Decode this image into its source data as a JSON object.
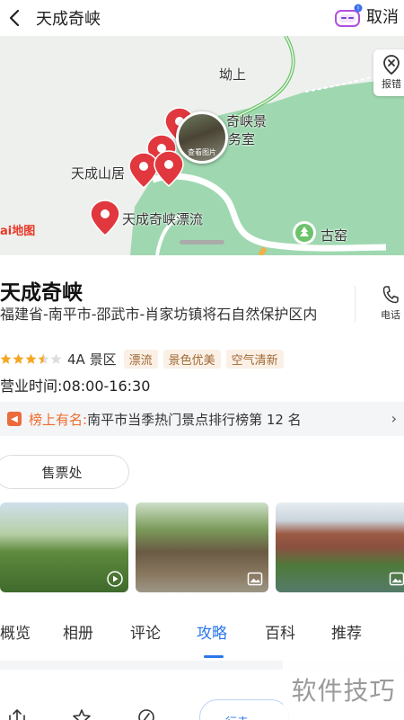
{
  "header": {
    "title": "天成奇峡",
    "cancel_label": "取消"
  },
  "map": {
    "labels": {
      "youshang": "坳上",
      "scenic_office_line1": "奇峡景",
      "scenic_office_line2": "务室",
      "tiancheng_shanju": "天成山居",
      "tiancheng_piaoliu": "天成奇峡漂流",
      "guyao": "古窑"
    },
    "photo_bubble_label": "查看图片",
    "report_label": "报错",
    "logo_text": "ai地图"
  },
  "poi": {
    "name": "天成奇峡",
    "address": "福建省-南平市-邵武市-肖家坊镇将石自然保护区内",
    "phone_label": "电话",
    "rating_stars": 3.5,
    "level": "4A 景区",
    "tags": [
      "漂流",
      "景色优美",
      "空气清新"
    ],
    "hours": "营业时间:08:00-16:30",
    "ranking_label": "榜上有名:",
    "ranking_text": "南平市当季热门景点排行榜第 12 名",
    "ticket_button": "售票处"
  },
  "tabs": [
    {
      "label": "概览",
      "active": false
    },
    {
      "label": "相册",
      "active": false
    },
    {
      "label": "评论",
      "active": false
    },
    {
      "label": "攻略",
      "active": true
    },
    {
      "label": "百科",
      "active": false
    },
    {
      "label": "推荐",
      "active": false
    }
  ],
  "bottombar": {
    "route_label": "行走"
  },
  "watermark": "软件技巧",
  "colors": {
    "accent": "#2a77e8",
    "marker": "#e0383e",
    "park_green": "#8fd0a4",
    "tag_text": "#a06a36",
    "ranking_label": "#f06a2a"
  }
}
